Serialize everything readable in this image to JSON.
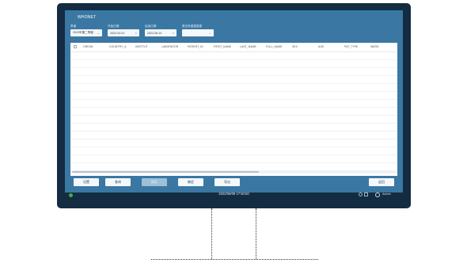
{
  "app": {
    "title": "WHONET"
  },
  "filters": [
    {
      "label": "季度",
      "value": "2022年第二季度"
    },
    {
      "label": "开始日期",
      "value": "2022-02-01"
    },
    {
      "label": "结束日期",
      "value": "2022-06-10"
    },
    {
      "label": "是否有重复数据",
      "value": ""
    }
  ],
  "table": {
    "columns": [
      "ORIGIN",
      "COUNTRY_A",
      "INSTITUT",
      "LABORATOR",
      "PATIENT_ID",
      "FIRST_NAME",
      "LAST_NAME",
      "FULL_NAME",
      "SEX",
      "AGE",
      "PAT_TYPE",
      "WARD"
    ],
    "rows": []
  },
  "toolbar": {
    "buttons": [
      {
        "label": "设置",
        "enabled": true
      },
      {
        "label": "查询",
        "enabled": true
      },
      {
        "label": "保存",
        "enabled": false
      },
      {
        "label": "确定",
        "enabled": true
      },
      {
        "label": "导出",
        "enabled": true
      },
      {
        "label": "返回",
        "enabled": true
      }
    ]
  },
  "status": {
    "datetime": "2022/06/09 17:50:50",
    "user": "Admin",
    "online_color": "#39b04b"
  }
}
